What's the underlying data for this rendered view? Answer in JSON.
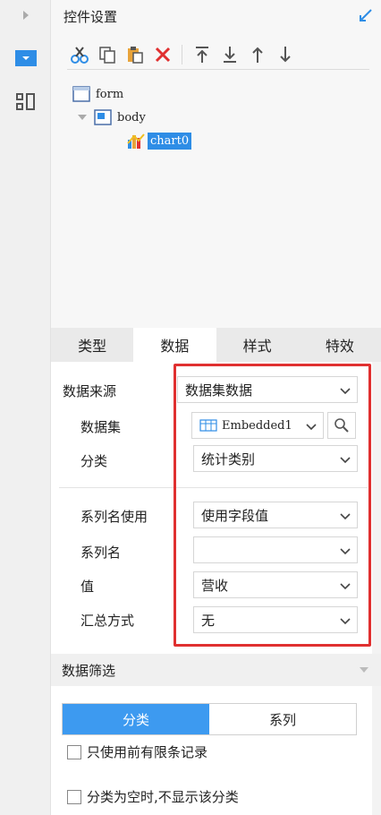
{
  "leftbar": {
    "icons": [
      "expand-arrow-icon",
      "widget-icon",
      "layout-icon"
    ]
  },
  "header": {
    "title": "控件设置",
    "collapse_icon": "collapse-arrow-icon"
  },
  "toolbar": {
    "icons": [
      "cut-icon",
      "copy-icon",
      "paste-icon",
      "delete-icon",
      "move-top-icon",
      "move-bottom-icon",
      "move-up-icon",
      "move-down-icon"
    ]
  },
  "tree": {
    "nodes": [
      {
        "label": "form"
      },
      {
        "label": "body"
      },
      {
        "label": "chart0",
        "selected": true
      }
    ]
  },
  "tabs": [
    "类型",
    "数据",
    "样式",
    "特效"
  ],
  "active_tab": "数据",
  "data": {
    "source_label": "数据来源",
    "source_value": "数据集数据",
    "dataset_label": "数据集",
    "dataset_value": "Embedded1",
    "category_label": "分类",
    "category_value": "统计类别",
    "series_use_label": "系列名使用",
    "series_use_value": "使用字段值",
    "series_name_label": "系列名",
    "series_name_value": "",
    "value_label": "值",
    "value_value": "营收",
    "summary_label": "汇总方式",
    "summary_value": "无"
  },
  "filter": {
    "title": "数据筛选",
    "seg_category": "分类",
    "seg_series": "系列",
    "check_first_records": "只使用前有限条记录",
    "check_hide_empty": "分类为空时,不显示该分类"
  },
  "colors": {
    "accent": "#2e8de6",
    "highlight": "#e03030"
  }
}
